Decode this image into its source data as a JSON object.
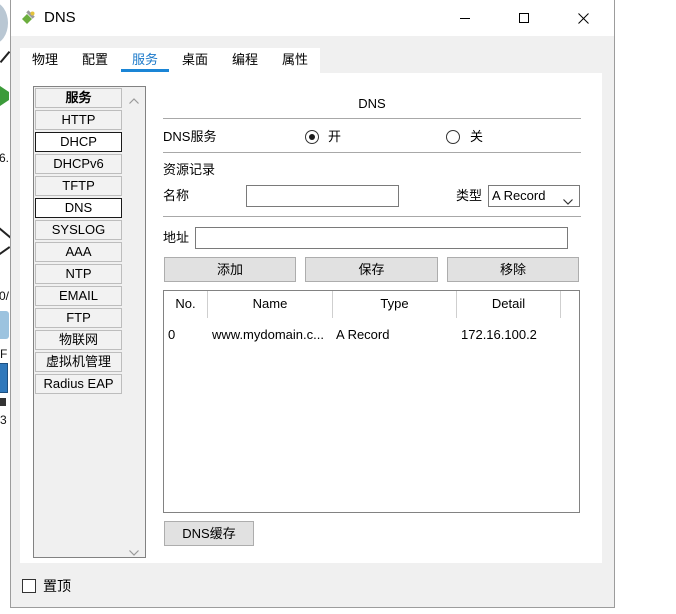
{
  "window": {
    "title": "DNS",
    "icons": {
      "app": "dns-server-icon",
      "minimize": "minimize-icon",
      "maximize": "maximize-icon",
      "close": "close-icon"
    }
  },
  "background": {
    "fragments": [
      "6.",
      "0/",
      "F",
      "3"
    ]
  },
  "tabs": [
    {
      "label": "物理",
      "selected": false
    },
    {
      "label": "配置",
      "selected": false
    },
    {
      "label": "服务",
      "selected": true
    },
    {
      "label": "桌面",
      "selected": false
    },
    {
      "label": "编程",
      "selected": false
    },
    {
      "label": "属性",
      "selected": false
    }
  ],
  "services": {
    "header": "服务",
    "items": [
      {
        "label": "HTTP"
      },
      {
        "label": "DHCP",
        "focused": true
      },
      {
        "label": "DHCPv6"
      },
      {
        "label": "TFTP"
      },
      {
        "label": "DNS",
        "selected": true
      },
      {
        "label": "SYSLOG"
      },
      {
        "label": "AAA"
      },
      {
        "label": "NTP"
      },
      {
        "label": "EMAIL"
      },
      {
        "label": "FTP"
      },
      {
        "label": "物联网"
      },
      {
        "label": "虚拟机管理"
      },
      {
        "label": "Radius EAP"
      }
    ],
    "scrollbar_icons": {
      "up": "chevron-up-icon",
      "down": "chevron-down-icon"
    }
  },
  "dns": {
    "title": "DNS",
    "service_label": "DNS服务",
    "on_label": "开",
    "off_label": "关",
    "service_enabled": true,
    "records_label": "资源记录",
    "name_label": "名称",
    "name_value": "",
    "type_label": "类型",
    "type_value": "A Record",
    "address_label": "地址",
    "address_value": "",
    "buttons": {
      "add": "添加",
      "save": "保存",
      "remove": "移除"
    },
    "table": {
      "columns": [
        "No.",
        "Name",
        "Type",
        "Detail"
      ],
      "rows": [
        [
          "0",
          "www.mydomain.c...",
          "A Record",
          "172.16.100.2"
        ]
      ]
    },
    "cache_button": "DNS缓存"
  },
  "footer": {
    "always_on_top_label": "置顶",
    "always_on_top_checked": false
  },
  "colors": {
    "accent": "#1a85d6",
    "selected_tab_text": "#1a78c9",
    "window_bg": "#f0f0f0",
    "panel_bg": "#ffffff",
    "button_bg": "#e1e1e1",
    "button_border": "#adadad",
    "selected_border": "#1a1a1a"
  }
}
